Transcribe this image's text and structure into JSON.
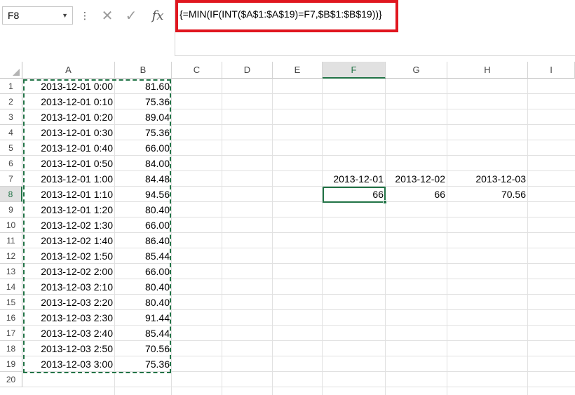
{
  "name_box": {
    "value": "F8"
  },
  "formula_bar": {
    "more_label": "⋮",
    "cancel_glyph": "✕",
    "enter_glyph": "✓",
    "fx_label": "fx",
    "formula": "{=MIN(IF(INT($A$1:$A$19)=F7,$B$1:$B$19))}",
    "highlight_color": "#e0161f"
  },
  "columns": [
    "A",
    "B",
    "C",
    "D",
    "E",
    "F",
    "G",
    "H",
    "I"
  ],
  "selected_column": "F",
  "rows": [
    "1",
    "2",
    "3",
    "4",
    "5",
    "6",
    "7",
    "8",
    "9",
    "10",
    "11",
    "12",
    "13",
    "14",
    "15",
    "16",
    "17",
    "18",
    "19",
    "20"
  ],
  "selected_row": "8",
  "data_rows": [
    {
      "a": "2013-12-01 0:00",
      "b": "81.60"
    },
    {
      "a": "2013-12-01 0:10",
      "b": "75.36"
    },
    {
      "a": "2013-12-01 0:20",
      "b": "89.04"
    },
    {
      "a": "2013-12-01 0:30",
      "b": "75.36"
    },
    {
      "a": "2013-12-01 0:40",
      "b": "66.00"
    },
    {
      "a": "2013-12-01 0:50",
      "b": "84.00"
    },
    {
      "a": "2013-12-01 1:00",
      "b": "84.48"
    },
    {
      "a": "2013-12-01 1:10",
      "b": "94.56"
    },
    {
      "a": "2013-12-01 1:20",
      "b": "80.40"
    },
    {
      "a": "2013-12-02 1:30",
      "b": "66.00"
    },
    {
      "a": "2013-12-02 1:40",
      "b": "86.40"
    },
    {
      "a": "2013-12-02 1:50",
      "b": "85.44"
    },
    {
      "a": "2013-12-02 2:00",
      "b": "66.00"
    },
    {
      "a": "2013-12-03 2:10",
      "b": "80.40"
    },
    {
      "a": "2013-12-03 2:20",
      "b": "80.40"
    },
    {
      "a": "2013-12-03 2:30",
      "b": "91.44"
    },
    {
      "a": "2013-12-03 2:40",
      "b": "85.44"
    },
    {
      "a": "2013-12-03 2:50",
      "b": "70.56"
    },
    {
      "a": "2013-12-03 3:00",
      "b": "75.36"
    }
  ],
  "summary": {
    "dates": [
      "2013-12-01",
      "2013-12-02",
      "2013-12-03"
    ],
    "mins": [
      "66",
      "66",
      "70.56"
    ]
  },
  "accent_color": "#217346"
}
